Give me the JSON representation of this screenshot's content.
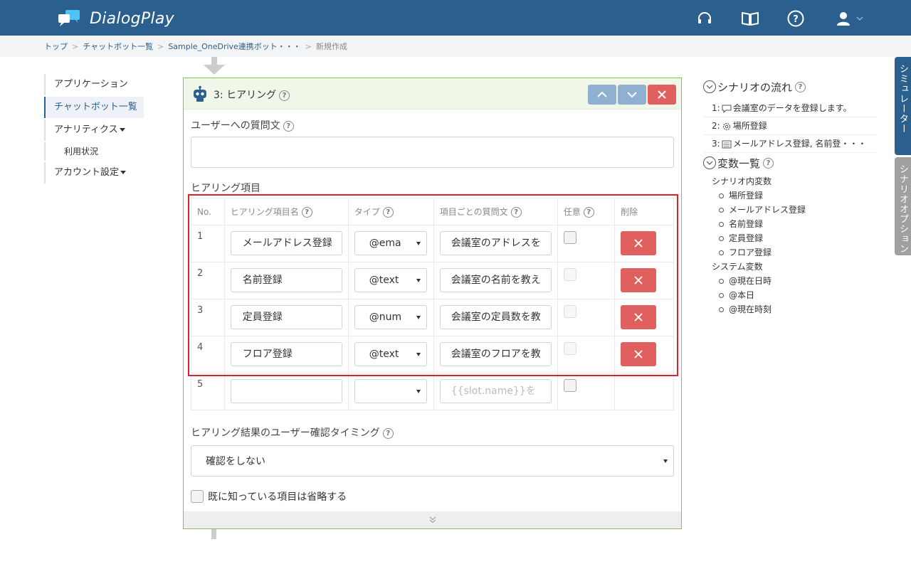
{
  "app": {
    "name": "DialogPlay"
  },
  "header_icons": [
    "headset-icon",
    "book-icon",
    "help-icon",
    "user-icon"
  ],
  "breadcrumb": [
    "トップ",
    "チャットボット一覧",
    "Sample_OneDrive連携ボット・・・",
    "新規作成"
  ],
  "nav": {
    "applications": "アプリケーション",
    "chatbots": "チャットボット一覧",
    "analytics": "アナリティクス",
    "usage": "利用状況",
    "account": "アカウント設定"
  },
  "card": {
    "title": "3: ヒアリング",
    "question_label": "ユーザーへの質問文",
    "question_value": "",
    "items_label": "ヒアリング項目",
    "columns": {
      "no": "No.",
      "name": "ヒアリング項目名",
      "type": "タイプ",
      "question": "項目ごとの質問文",
      "optional": "任意",
      "delete": "削除"
    },
    "rows": [
      {
        "no": "1",
        "name": "メールアドレス登録",
        "type": "@ema",
        "question": "会議室のアドレスを",
        "optional": false
      },
      {
        "no": "2",
        "name": "名前登録",
        "type": "@text",
        "question": "会議室の名前を教え",
        "optional": false
      },
      {
        "no": "3",
        "name": "定員登録",
        "type": "@num",
        "question": "会議室の定員数を教",
        "optional": false
      },
      {
        "no": "4",
        "name": "フロア登録",
        "type": "@text",
        "question": "会議室のフロアを教",
        "optional": false
      }
    ],
    "new_row": {
      "no": "5",
      "name": "",
      "type": "",
      "question_placeholder": "{{slot.name}}を"
    },
    "confirm_label": "ヒアリング結果のユーザー確認タイミング",
    "confirm_value": "確認をしない",
    "skip_label": "既に知っている項目は省略する"
  },
  "right": {
    "flow_title": "シナリオの流れ",
    "flow": [
      {
        "num": "1:",
        "icon": "speech-bubble-icon",
        "text": "会議室のデータを登録します。"
      },
      {
        "num": "2:",
        "icon": "gear-icon",
        "text": "場所登録"
      },
      {
        "num": "3:",
        "icon": "form-icon",
        "text": "メールアドレス登録, 名前登・・・"
      }
    ],
    "vars_title": "変数一覧",
    "scenario_vars_label": "シナリオ内変数",
    "scenario_vars": [
      "場所登録",
      "メールアドレス登録",
      "名前登録",
      "定員登録",
      "フロア登録"
    ],
    "system_vars_label": "システム変数",
    "system_vars": [
      "@現在日時",
      "@本日",
      "@現在時刻"
    ]
  },
  "side_tabs": {
    "simulator": "シミュレーター",
    "options": "シナリオオプション"
  },
  "colors": {
    "header": "#2b5f8e",
    "accent_green": "#8bc34a",
    "danger": "#e06060",
    "highlight": "#e0202a"
  }
}
